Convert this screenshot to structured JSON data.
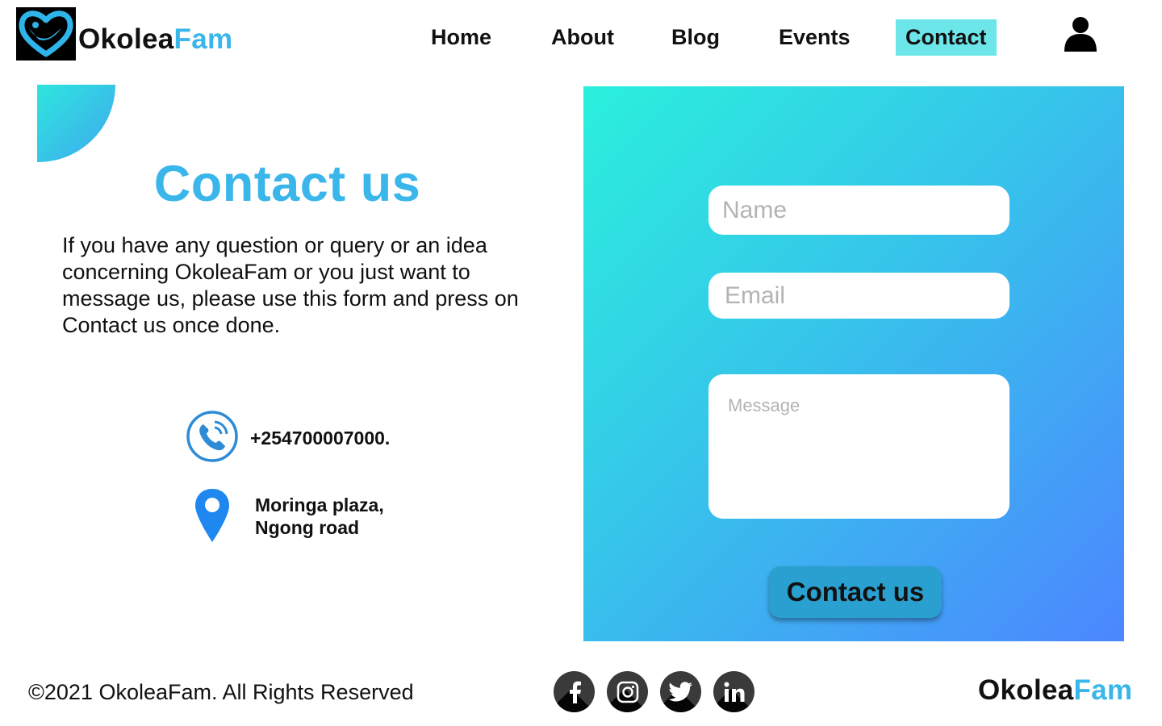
{
  "brand": {
    "name_part1": "Okolea",
    "name_part2": "Fam",
    "logo_icon": "heart-hands-icon"
  },
  "nav": {
    "items": [
      {
        "label": "Home"
      },
      {
        "label": "About"
      },
      {
        "label": "Blog"
      },
      {
        "label": "Events"
      },
      {
        "label": "Contact",
        "active": true
      }
    ],
    "user_icon": "user-icon"
  },
  "main": {
    "title": "Contact us",
    "intro": "If you have any question or query or an idea concerning OkoleaFam or you just want to message us, please use this form and press on Contact us once done.",
    "phone": "+254700007000.",
    "address_line1": "Moringa plaza,",
    "address_line2": "Ngong road"
  },
  "form": {
    "name_placeholder": "Name",
    "email_placeholder": "Email",
    "message_placeholder": "Message",
    "submit_label": "Contact us"
  },
  "footer": {
    "copyright": "©2021 OkoleaFam. All Rights Reserved",
    "socials": [
      "facebook-icon",
      "instagram-icon",
      "twitter-icon",
      "linkedin-icon"
    ],
    "brand_part1": "Okolea",
    "brand_part2": "Fam"
  },
  "colors": {
    "accent": "#3ab6ea",
    "nav_active": "#6de6ea",
    "panel_start": "#2af0dc",
    "panel_end": "#4c86ff",
    "button": "#2aa0d0"
  }
}
